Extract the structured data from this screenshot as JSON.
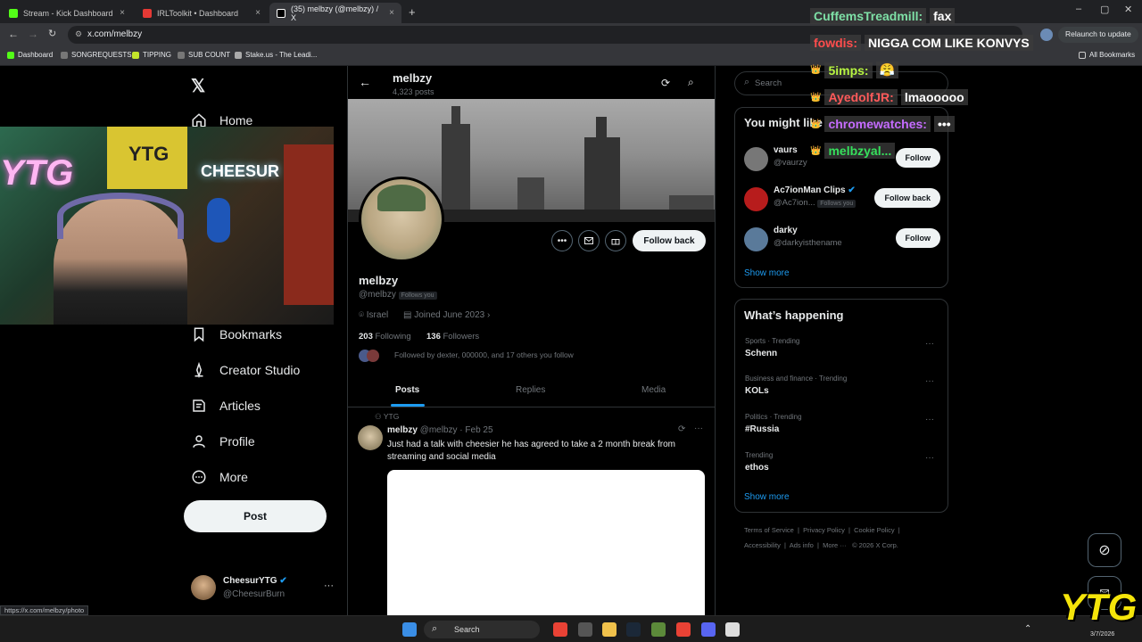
{
  "browser": {
    "tabs": [
      {
        "label": "Stream - Kick Dashboard",
        "color": "#53fc18"
      },
      {
        "label": "IRLToolkit • Dashboard",
        "color": "#e53935"
      },
      {
        "label": "(35) melbzy (@melbzy) / X",
        "color": "#ffffff"
      }
    ],
    "url": "x.com/melbzy",
    "relaunch_label": "Relaunch to update",
    "bookmarks": [
      "Dashboard",
      "SONGREQUESTS",
      "TIPPING",
      "SUB COUNT",
      "Stake.us - The Leadi..."
    ],
    "all_bookmarks": "All Bookmarks",
    "status_url": "https://x.com/melbzy/photo"
  },
  "nav": {
    "home": "Home",
    "bookmarks": "Bookmarks",
    "creator_studio": "Creator Studio",
    "articles": "Articles",
    "profile": "Profile",
    "more": "More",
    "post": "Post",
    "account_name": "CheesurYTG",
    "account_handle": "@CheesurBurn"
  },
  "profile": {
    "header_name": "melbzy",
    "post_count": "4,323 posts",
    "name": "melbzy",
    "handle": "@melbzy",
    "follows_you": "Follows you",
    "location": "Israel",
    "joined": "Joined June 2023",
    "following_count": "203",
    "following_label": "Following",
    "followers_count": "136",
    "followers_label": "Followers",
    "followed_by": "Followed by dexter, 000000, and 17 others you follow",
    "follow_back": "Follow back",
    "tabs": [
      "Posts",
      "Replies",
      "Media"
    ]
  },
  "post": {
    "repost_label": "YTG",
    "name": "melbzy",
    "handle": "@melbzy",
    "date": "Feb 25",
    "text": "Just had a talk with cheesier he has agreed to take a 2 month break from streaming and social media"
  },
  "right": {
    "search_placeholder": "Search",
    "you_might_like": "You might like",
    "suggestions": [
      {
        "name": "vaurs",
        "handle": "@vaurzy",
        "button": "Follow"
      },
      {
        "name": "Ac7ionMan Clips",
        "handle": "@Ac7ion...",
        "badge": "Follows you",
        "button": "Follow back"
      },
      {
        "name": "darky",
        "handle": "@darkyisthename",
        "button": "Follow"
      }
    ],
    "show_more": "Show more",
    "whats_happening": "What’s happening",
    "trends": [
      {
        "category": "Sports · Trending",
        "topic": "Schenn"
      },
      {
        "category": "Business and finance · Trending",
        "topic": "KOLs"
      },
      {
        "category": "Politics · Trending",
        "topic": "#Russia"
      },
      {
        "category": "Trending",
        "topic": "ethos"
      }
    ],
    "show_more_2": "Show more",
    "footer_1": [
      "Terms of Service",
      "Privacy Policy",
      "Cookie Policy"
    ],
    "footer_2": [
      "Accessibility",
      "Ads info",
      "More ···",
      "© 2026 X Corp."
    ]
  },
  "chat": [
    {
      "name": "CuffemsTreadmill:",
      "msg": "fax",
      "color": "#7ee0a6"
    },
    {
      "name": "fowdis:",
      "msg": "NIGGA COM LIKE KONVYS",
      "color": "#ff4d4d"
    },
    {
      "name": "5imps:",
      "msg": "😤",
      "color": "#b7f542"
    },
    {
      "name": "AyedolfJR:",
      "msg": "lmaooooo",
      "color": "#ff5a5a"
    },
    {
      "name": "chromewatches:",
      "msg": "•••",
      "color": "#c56cff"
    },
    {
      "name": "melbzyal...",
      "msg": "",
      "color": "#36e05c"
    }
  ],
  "webcam_text": {
    "sign_left": "YTG",
    "sign_banner": "YTG",
    "sign_right": "CHEESUR"
  },
  "taskbar": {
    "search": "Search",
    "date": "3/7/2026"
  },
  "watermark": "YTG"
}
